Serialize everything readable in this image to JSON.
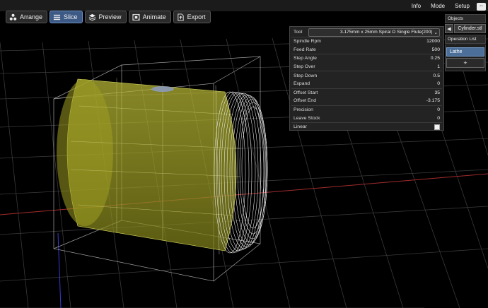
{
  "toolbar": {
    "arrange": "Arrange",
    "slice": "Slice",
    "preview": "Preview",
    "animate": "Animate",
    "export": "Export"
  },
  "menu": {
    "info": "Info",
    "mode": "Mode",
    "setup": "Setup"
  },
  "params": {
    "tool_label": "Tool",
    "tool_value": "3.175mm x 25mm Spiral O Single Flute(200)",
    "rows": [
      {
        "label": "Spindle Rpm",
        "value": "12000"
      },
      {
        "label": "Feed Rate",
        "value": "500"
      },
      {
        "label": "Step Angle",
        "value": "0.25"
      },
      {
        "label": "Step Over",
        "value": "1"
      },
      {
        "label": "Step Down",
        "value": "0.5"
      },
      {
        "label": "Expand",
        "value": "0"
      },
      {
        "label": "Offset Start",
        "value": "35"
      },
      {
        "label": "Offset End",
        "value": "-3.175"
      },
      {
        "label": "Precision",
        "value": "0"
      },
      {
        "label": "Leave Stock",
        "value": "0"
      },
      {
        "label": "Linear",
        "value": ""
      }
    ]
  },
  "side": {
    "objects_title": "Objects",
    "object_name": "Cylinder.stl",
    "oplist_title": "Operation List",
    "operations": [
      "Lathe"
    ],
    "add_label": "+"
  },
  "colors": {
    "accent": "#3d5a86",
    "cylinder_fill": "#c8c832",
    "grid": "#3a3a3a",
    "x_axis": "#b03030",
    "y_axis": "#3030b0"
  }
}
